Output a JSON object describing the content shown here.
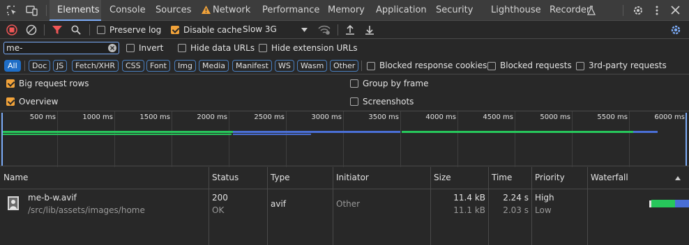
{
  "devtools_tabs": [
    "Elements",
    "Console",
    "Sources",
    "Network",
    "Performance",
    "Memory",
    "Application",
    "Security",
    "Lighthouse",
    "Recorder"
  ],
  "toolbar": {
    "preserve_log": {
      "label": "Preserve log",
      "checked": false
    },
    "disable_cache": {
      "label": "Disable cache",
      "checked": true
    },
    "throttle": "Slow 3G"
  },
  "filter": {
    "value": "me-",
    "invert_label": "Invert",
    "hide_data_urls_label": "Hide data URLs",
    "hide_extension_urls_label": "Hide extension URLs"
  },
  "type_filters": [
    "All",
    "Doc",
    "JS",
    "Fetch/XHR",
    "CSS",
    "Font",
    "Img",
    "Media",
    "Manifest",
    "WS",
    "Wasm",
    "Other"
  ],
  "extra_filters": {
    "blocked_cookies": "Blocked response cookies",
    "blocked_requests": "Blocked requests",
    "third_party": "3rd-party requests"
  },
  "options": {
    "big_request_rows": {
      "label": "Big request rows",
      "checked": true
    },
    "group_by_frame": {
      "label": "Group by frame",
      "checked": false
    },
    "overview": {
      "label": "Overview",
      "checked": true
    },
    "screenshots": {
      "label": "Screenshots",
      "checked": false
    }
  },
  "overview_ticks": [
    "500 ms",
    "1000 ms",
    "1500 ms",
    "2000 ms",
    "2500 ms",
    "3000 ms",
    "3500 ms",
    "4000 ms",
    "4500 ms",
    "5000 ms",
    "5500 ms",
    "6000 ms"
  ],
  "columns": [
    "Name",
    "Status",
    "Type",
    "Initiator",
    "Size",
    "Time",
    "Priority",
    "Waterfall"
  ],
  "requests": [
    {
      "name": "me-b-w.avif",
      "path": "/src/lib/assets/images/home",
      "status": "200",
      "status_text": "OK",
      "type": "avif",
      "initiator": "Other",
      "size": "11.4 kB",
      "resource_size": "11.1 kB",
      "time": "2.24 s",
      "latency": "2.03 s",
      "priority": "High",
      "initial_priority": "Low"
    }
  ],
  "colors": {
    "accent": "#7cacf8",
    "network_warning": "#f2a33a",
    "filter_red": "#f05656",
    "waterfall_green": "#27c75b",
    "waterfall_blue": "#4a6fd6"
  }
}
